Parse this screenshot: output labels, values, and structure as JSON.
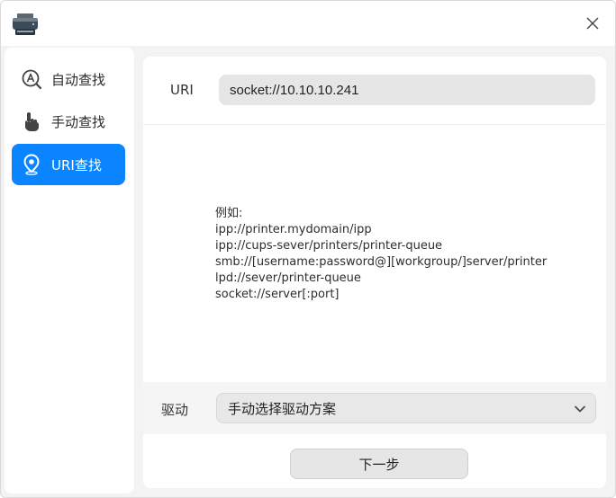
{
  "window": {
    "app_icon": "printer-icon",
    "close_icon": "close-icon"
  },
  "sidebar": {
    "items": [
      {
        "label": "自动查找",
        "icon": "auto-search-icon",
        "active": false
      },
      {
        "label": "手动查找",
        "icon": "hand-pointer-icon",
        "active": false
      },
      {
        "label": "URI查找",
        "icon": "location-pin-icon",
        "active": true
      }
    ]
  },
  "uri": {
    "label": "URI",
    "value": "socket://10.10.10.241"
  },
  "examples": {
    "heading": "例如:",
    "lines": [
      "ipp://printer.mydomain/ipp",
      "ipp://cups-sever/printers/printer-queue",
      "smb://[username:password@][workgroup/]server/printer",
      "lpd://sever/printer-queue",
      "socket://server[:port]"
    ]
  },
  "driver": {
    "label": "驱动",
    "selected": "手动选择驱动方案"
  },
  "next_button": "下一步",
  "colors": {
    "accent": "#0a84ff",
    "window_bg": "#f3f3f3",
    "panel_bg": "#ffffff"
  }
}
